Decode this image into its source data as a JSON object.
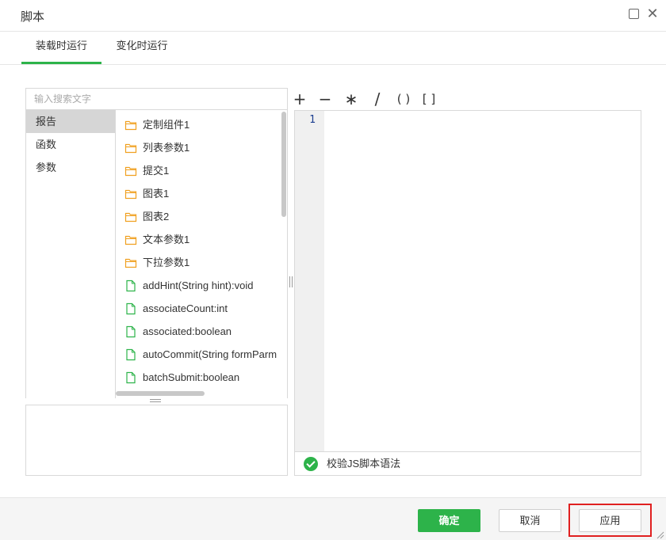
{
  "window": {
    "title": "脚本",
    "maximize_icon": "square-icon",
    "close_icon": "close-icon"
  },
  "tabs": [
    {
      "label": "装载时运行",
      "active": true
    },
    {
      "label": "变化时运行",
      "active": false
    }
  ],
  "search": {
    "placeholder": "输入搜索文字",
    "value": ""
  },
  "categories": [
    {
      "label": "报告",
      "active": true
    },
    {
      "label": "函数",
      "active": false
    },
    {
      "label": "参数",
      "active": false
    }
  ],
  "items": [
    {
      "label": "定制组件1",
      "icon": "folder-icon"
    },
    {
      "label": "列表参数1",
      "icon": "folder-icon"
    },
    {
      "label": "提交1",
      "icon": "folder-icon"
    },
    {
      "label": "图表1",
      "icon": "folder-icon"
    },
    {
      "label": "图表2",
      "icon": "folder-icon"
    },
    {
      "label": "文本参数1",
      "icon": "folder-icon"
    },
    {
      "label": "下拉参数1",
      "icon": "folder-icon"
    },
    {
      "label": "addHint(String hint):void",
      "icon": "file-icon"
    },
    {
      "label": "associateCount:int",
      "icon": "file-icon"
    },
    {
      "label": "associated:boolean",
      "icon": "file-icon"
    },
    {
      "label": "autoCommit(String formParm",
      "icon": "file-icon"
    },
    {
      "label": "batchSubmit:boolean",
      "icon": "file-icon"
    }
  ],
  "operators": [
    "+",
    "−",
    "∗",
    "/",
    "( )",
    "[ ]"
  ],
  "editor": {
    "line_numbers": [
      "1"
    ],
    "content": ""
  },
  "status": {
    "label": "校验JS脚本语法",
    "icon": "check-circle-icon"
  },
  "buttons": {
    "ok": "确定",
    "cancel": "取消",
    "apply": "应用"
  },
  "colors": {
    "accent": "#2db34a",
    "folder": "#f0a020",
    "file": "#2db34a",
    "highlight": "#e02020"
  }
}
